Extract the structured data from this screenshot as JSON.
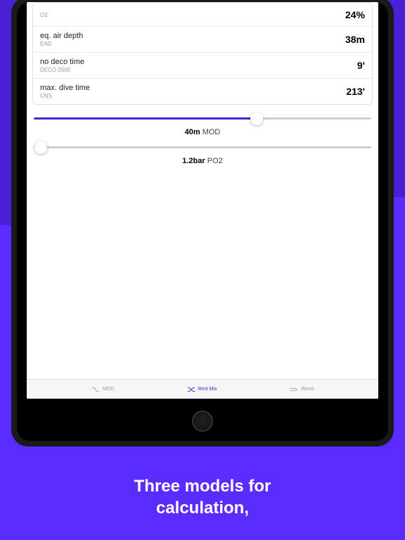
{
  "rows": [
    {
      "label": "",
      "sublabel": "O2",
      "value": "24%"
    },
    {
      "label": "eq. air depth",
      "sublabel": "EAD",
      "value": "38m"
    },
    {
      "label": "no deco time",
      "sublabel": "DECO 2000",
      "value": "9'"
    },
    {
      "label": "max. dive time",
      "sublabel": "CNS",
      "value": "213'"
    }
  ],
  "sliders": {
    "depth": {
      "value_bold": "40m",
      "value_suffix": " MOD",
      "fill_pct": 66
    },
    "po2": {
      "value_bold": "1.2bar",
      "value_suffix": " PO2",
      "fill_pct": 0
    }
  },
  "tabs": {
    "mod": "MOD",
    "bestmix": "Best Mix",
    "blend": "Blend"
  },
  "marketing": {
    "line1": "Three models for",
    "line2": "calculation,"
  }
}
